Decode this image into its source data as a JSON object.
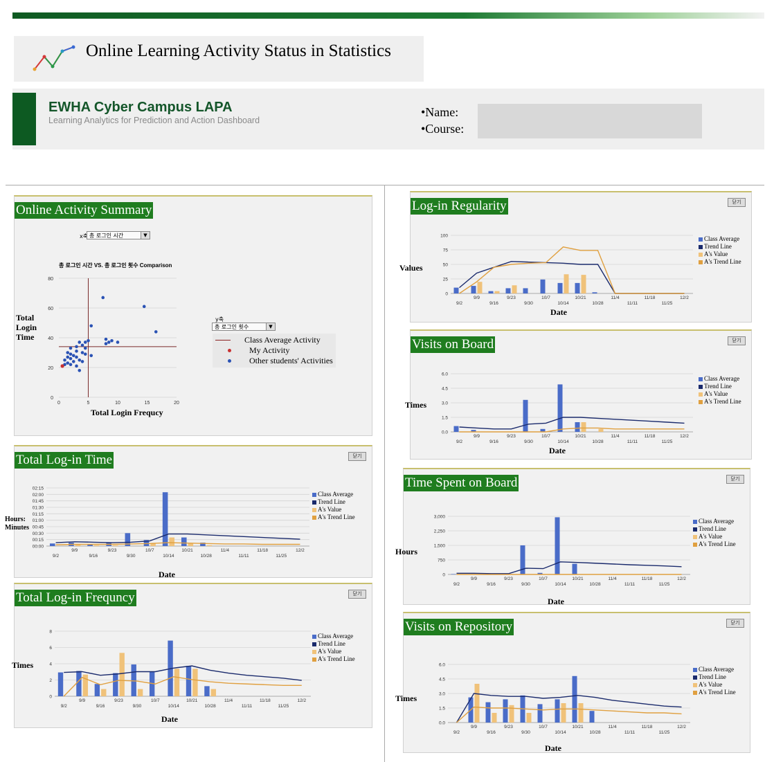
{
  "header": {
    "title": "Online Learning Activity Status in Statistics",
    "brand": "EWHA Cyber Campus LAPA",
    "brand_sub": "Learning Analytics for Prediction and Action Dashboard",
    "name_label": "•Name:",
    "course_label": "•Course:"
  },
  "colors": {
    "class_avg": "#4a6cc8",
    "trend": "#1a2a6c",
    "a_value": "#f0c27a",
    "a_trend": "#e0a040",
    "title_bg": "#1f7d1f"
  },
  "buttons": {
    "detail": "닫기"
  },
  "legend": {
    "class_average": "Class Average",
    "trend_line": "Trend Line",
    "a_value": "A's Value",
    "a_trend": "A's Trend Line"
  },
  "summary": {
    "title": "Online Activity Summary",
    "x_select_label": "x축",
    "x_select_value": "총 로그인 시간",
    "y_select_label": "y축",
    "y_select_value": "총 로그인 횟수",
    "chart_title": "총 로그인 시간 VS. 총 로그인 횟수 Comparison",
    "ylabel": "Total Login Time",
    "xlabel": "Total Login Frequcy",
    "legend_avg": "Class Average Activity",
    "legend_my": "My Activity",
    "legend_other": "Other students' Activities"
  },
  "panels": {
    "login_time": {
      "title": "Total Log-in Time",
      "ylabel": "Hours: Minutes",
      "xlabel": "Date"
    },
    "login_freq": {
      "title": "Total Log-in Frequncy",
      "ylabel": "Times",
      "xlabel": "Date"
    },
    "regularity": {
      "title": "Log-in Regularity",
      "ylabel": "Values",
      "xlabel": "Date"
    },
    "visits_board": {
      "title": "Visits on Board",
      "ylabel": "Times",
      "xlabel": "Date"
    },
    "time_board": {
      "title": "Time Spent on Board",
      "ylabel": "Hours",
      "xlabel": "Date"
    },
    "visits_repo": {
      "title": "Visits on Repository",
      "ylabel": "Times",
      "xlabel": "Date"
    }
  },
  "chart_data": [
    {
      "id": "summary",
      "type": "scatter",
      "title": "총 로그인 시간 VS. 총 로그인 횟수 Comparison",
      "xlabel": "Total Login Frequcy",
      "ylabel": "Total Login Time",
      "xlim": [
        0,
        20
      ],
      "ylim": [
        0,
        80
      ],
      "xticks": [
        "0",
        "5",
        "10",
        "15",
        "20"
      ],
      "yticks": [
        "0",
        "20",
        "40",
        "60",
        "80"
      ],
      "class_average": {
        "x": 5,
        "y": 34
      },
      "my_activity": {
        "x": 0.6,
        "y": 21
      },
      "others": [
        [
          1,
          22
        ],
        [
          1.5,
          23
        ],
        [
          2,
          22
        ],
        [
          2.5,
          24
        ],
        [
          3,
          21
        ],
        [
          1,
          25
        ],
        [
          1.5,
          27
        ],
        [
          2,
          26
        ],
        [
          2.5,
          28
        ],
        [
          3,
          27
        ],
        [
          3.5,
          25
        ],
        [
          4,
          24
        ],
        [
          1.5,
          30
        ],
        [
          2,
          29
        ],
        [
          3,
          31
        ],
        [
          4,
          30
        ],
        [
          4.5,
          29
        ],
        [
          2,
          33
        ],
        [
          3,
          34
        ],
        [
          4,
          35
        ],
        [
          4.5,
          33
        ],
        [
          3.5,
          37
        ],
        [
          4.5,
          37
        ],
        [
          3.5,
          18
        ],
        [
          5.5,
          28
        ],
        [
          5,
          38
        ],
        [
          8,
          39
        ],
        [
          8.5,
          37
        ],
        [
          9,
          38
        ],
        [
          8,
          36
        ],
        [
          10,
          37
        ],
        [
          5.5,
          48
        ],
        [
          7.5,
          67
        ],
        [
          14.5,
          61
        ],
        [
          16.5,
          44
        ]
      ]
    },
    {
      "id": "login_time",
      "type": "bar",
      "categories": [
        "9/2",
        "9/9",
        "9/16",
        "9/23",
        "9/30",
        "10/7",
        "10/14",
        "10/21",
        "10/28",
        "11/4",
        "11/11",
        "11/18",
        "11/25",
        "12/2"
      ],
      "yticks": [
        "00:00",
        "00:15",
        "00:30",
        "00:45",
        "01:00",
        "01:15",
        "01:30",
        "01:45",
        "02:00",
        "02:15"
      ],
      "ylim": [
        0,
        135
      ],
      "series": [
        {
          "name": "Class Average",
          "values": [
            6,
            8,
            4,
            8,
            30,
            14,
            125,
            20,
            8,
            0,
            0,
            0,
            0,
            0
          ]
        },
        {
          "name": "Trend Line",
          "values": [
            8,
            10,
            9,
            8,
            9,
            12,
            28,
            28,
            26,
            24,
            22,
            20,
            18,
            16
          ]
        },
        {
          "name": "A's Value",
          "values": [
            0,
            3,
            2,
            2,
            0,
            6,
            20,
            7,
            2,
            0,
            0,
            0,
            0,
            0
          ]
        },
        {
          "name": "A's Trend Line",
          "values": [
            3,
            4,
            4,
            4,
            5,
            6,
            8,
            7,
            6,
            5,
            5,
            4,
            4,
            4
          ]
        }
      ]
    },
    {
      "id": "login_freq",
      "type": "bar",
      "categories": [
        "9/2",
        "9/9",
        "9/16",
        "9/23",
        "9/30",
        "10/7",
        "10/14",
        "10/21",
        "10/28",
        "11/4",
        "11/11",
        "11/18",
        "11/25",
        "12/2"
      ],
      "yticks": [
        "0",
        "2",
        "4",
        "6",
        "8"
      ],
      "ylim": [
        0,
        9
      ],
      "series": [
        {
          "name": "Class Average",
          "values": [
            3.3,
            3.5,
            1.7,
            3.2,
            4.4,
            3.4,
            7.7,
            4.2,
            1.4,
            0,
            0,
            0,
            0,
            0
          ]
        },
        {
          "name": "Trend Line",
          "values": [
            3.3,
            3.4,
            2.9,
            3.1,
            3.4,
            3.4,
            3.9,
            4.2,
            3.6,
            3.2,
            2.9,
            2.7,
            2.5,
            2.2
          ]
        },
        {
          "name": "A's Value",
          "values": [
            0,
            3.0,
            1.0,
            6.0,
            1.0,
            0,
            3.8,
            3.8,
            1.0,
            0,
            0,
            0,
            0,
            0
          ]
        },
        {
          "name": "A's Trend Line",
          "values": [
            0,
            2.6,
            1.6,
            2.2,
            2.1,
            1.7,
            2.7,
            2.3,
            2.0,
            1.8,
            1.7,
            1.6,
            1.5,
            1.5
          ]
        }
      ]
    },
    {
      "id": "regularity",
      "type": "bar",
      "categories": [
        "9/2",
        "9/9",
        "9/16",
        "9/23",
        "9/30",
        "10/7",
        "10/14",
        "10/21",
        "10/28",
        "11/4",
        "11/11",
        "11/18",
        "11/25",
        "12/2"
      ],
      "yticks": [
        "0",
        "25",
        "50",
        "75",
        "100"
      ],
      "ylim": [
        0,
        100
      ],
      "series": [
        {
          "name": "Class Average",
          "values": [
            10,
            13,
            4,
            9,
            9,
            24,
            18,
            18,
            2,
            0,
            0,
            0,
            0,
            0
          ]
        },
        {
          "name": "Trend Line",
          "values": [
            10,
            35,
            45,
            55,
            54,
            53,
            52,
            50,
            50,
            0,
            0,
            0,
            0,
            0
          ]
        },
        {
          "name": "A's Value",
          "values": [
            0,
            20,
            4,
            14,
            0,
            0,
            33,
            32,
            0,
            0,
            0,
            0,
            0,
            0
          ]
        },
        {
          "name": "A's Trend Line",
          "values": [
            0,
            20,
            45,
            50,
            52,
            53,
            80,
            74,
            74,
            0,
            0,
            0,
            0,
            0
          ]
        }
      ]
    },
    {
      "id": "visits_board",
      "type": "bar",
      "categories": [
        "9/2",
        "9/9",
        "9/16",
        "9/23",
        "9/30",
        "10/7",
        "10/14",
        "10/21",
        "10/28",
        "11/4",
        "11/11",
        "11/18",
        "11/25",
        "12/2"
      ],
      "yticks": [
        "0.0",
        "1.5",
        "3.0",
        "4.5",
        "6.0"
      ],
      "ylim": [
        0,
        6
      ],
      "series": [
        {
          "name": "Class Average",
          "values": [
            0.6,
            0.2,
            0,
            0,
            3.3,
            0.3,
            4.9,
            1.0,
            0,
            0,
            0,
            0,
            0,
            0
          ]
        },
        {
          "name": "Trend Line",
          "values": [
            0.5,
            0.4,
            0.3,
            0.3,
            0.8,
            0.9,
            1.5,
            1.5,
            1.4,
            1.3,
            1.2,
            1.1,
            1.0,
            0.9
          ]
        },
        {
          "name": "A's Value",
          "values": [
            0,
            0,
            0,
            0,
            0,
            0,
            0,
            1.0,
            0.3,
            0,
            0,
            0,
            0,
            0
          ]
        },
        {
          "name": "A's Trend Line",
          "values": [
            0,
            0,
            0,
            0,
            0,
            0,
            0.3,
            0.4,
            0.4,
            0.3,
            0.3,
            0.3,
            0.3,
            0.3
          ]
        }
      ]
    },
    {
      "id": "time_board",
      "type": "bar",
      "categories": [
        "9/2",
        "9/9",
        "9/16",
        "9/23",
        "9/30",
        "10/7",
        "10/14",
        "10/21",
        "10/28",
        "11/4",
        "11/11",
        "11/18",
        "11/25",
        "12/2"
      ],
      "yticks": [
        "0",
        "750",
        "1,500",
        "2,250",
        "3,000"
      ],
      "ylim": [
        0,
        3000
      ],
      "series": [
        {
          "name": "Class Average",
          "values": [
            20,
            10,
            0,
            0,
            1500,
            80,
            2950,
            550,
            0,
            0,
            0,
            0,
            0,
            0
          ]
        },
        {
          "name": "Trend Line",
          "values": [
            60,
            60,
            40,
            40,
            320,
            300,
            650,
            620,
            580,
            540,
            500,
            470,
            440,
            400
          ]
        },
        {
          "name": "A's Value",
          "values": [
            0,
            0,
            0,
            0,
            0,
            0,
            0,
            0,
            0,
            0,
            0,
            0,
            0,
            0
          ]
        },
        {
          "name": "A's Trend Line",
          "values": [
            0,
            0,
            0,
            0,
            0,
            0,
            0,
            0,
            0,
            0,
            0,
            0,
            0,
            0
          ]
        }
      ]
    },
    {
      "id": "visits_repo",
      "type": "bar",
      "categories": [
        "9/2",
        "9/9",
        "9/16",
        "9/23",
        "9/30",
        "10/7",
        "10/14",
        "10/21",
        "10/28",
        "11/4",
        "11/11",
        "11/18",
        "11/25",
        "12/2"
      ],
      "yticks": [
        "0.0",
        "1.5",
        "3.0",
        "4.5",
        "6.0"
      ],
      "ylim": [
        0,
        6
      ],
      "series": [
        {
          "name": "Class Average",
          "values": [
            0,
            2.6,
            2.1,
            2.4,
            2.8,
            1.9,
            2.4,
            4.8,
            1.2,
            0,
            0,
            0,
            0,
            0
          ]
        },
        {
          "name": "Trend Line",
          "values": [
            0,
            3.0,
            2.8,
            2.7,
            2.7,
            2.5,
            2.6,
            2.8,
            2.6,
            2.3,
            2.1,
            1.9,
            1.7,
            1.6
          ]
        },
        {
          "name": "A's Value",
          "values": [
            0,
            4.0,
            1.0,
            1.8,
            1.0,
            0,
            2.0,
            2.0,
            0,
            0,
            0,
            0,
            0,
            0
          ]
        },
        {
          "name": "A's Trend Line",
          "values": [
            0,
            1.6,
            1.5,
            1.5,
            1.4,
            1.3,
            1.4,
            1.4,
            1.3,
            1.2,
            1.1,
            1.0,
            1.0,
            0.9
          ]
        }
      ]
    }
  ]
}
